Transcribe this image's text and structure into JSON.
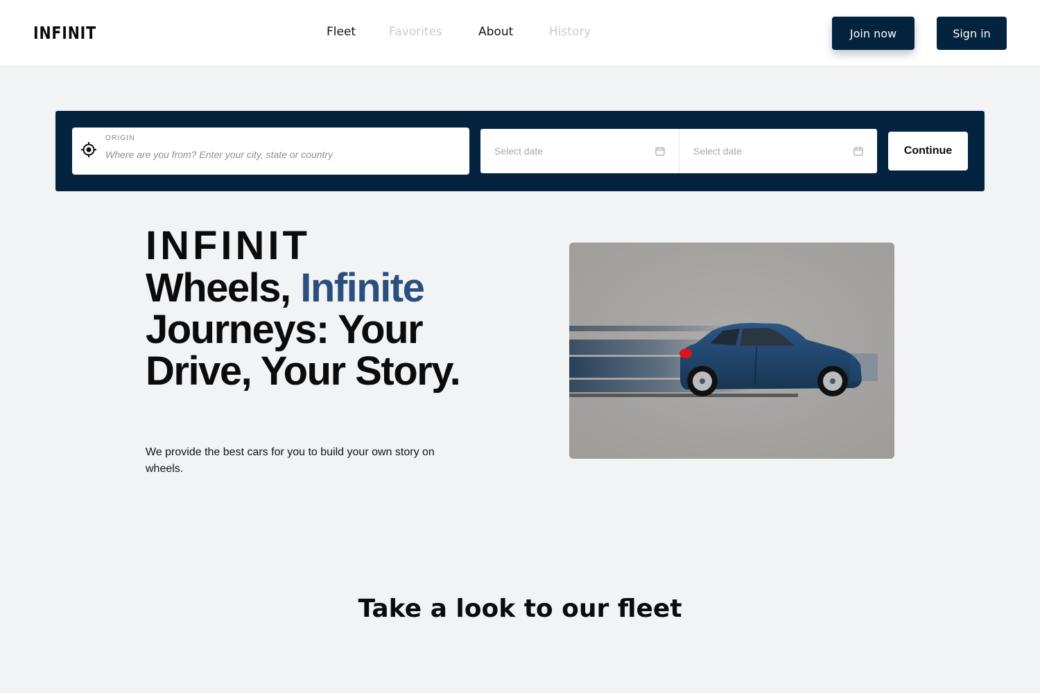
{
  "app": {
    "logo": "INFINIT"
  },
  "nav": {
    "items": [
      {
        "label": "Fleet",
        "active": true
      },
      {
        "label": "Favorites",
        "active": false
      },
      {
        "label": "About",
        "active": true
      },
      {
        "label": "History",
        "active": false
      }
    ],
    "join_label": "Join now",
    "signin_label": "Sign in"
  },
  "search": {
    "origin_label": "ORIGIN",
    "origin_placeholder": "Where are you from? Enter your city, state or country",
    "start_date": "Select date",
    "end_date": "Select date",
    "continue_label": "Continue"
  },
  "hero": {
    "brand": "INFINIT",
    "tagline_part1": "Wheels, ",
    "tagline_accent": "Infinite",
    "tagline_part2": " Journeys: Your Drive, Your Story.",
    "description": "We provide the best cars for you to build your own story on wheels.",
    "image_alt": "blue hatchback car in motion"
  },
  "fleet": {
    "title": "Take a look to our fleet"
  },
  "colors": {
    "navy": "#04233f",
    "accent_blue": "#2b4f7d",
    "background": "#f2f3f5",
    "nav_inactive": "#c6cad1"
  }
}
